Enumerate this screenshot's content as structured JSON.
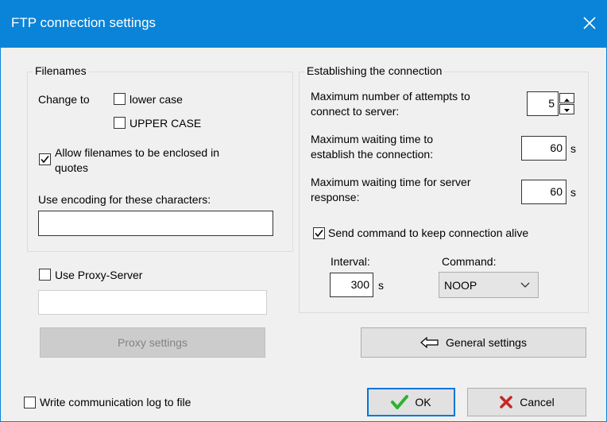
{
  "window": {
    "title": "FTP connection settings"
  },
  "filenames": {
    "legend": "Filenames",
    "change_to": "Change to",
    "lower_case": {
      "label": "lower case",
      "checked": false
    },
    "upper_case": {
      "label": "UPPER CASE",
      "checked": false
    },
    "allow_quotes": {
      "label_line1": "Allow filenames to be enclosed in",
      "label_line2": "quotes",
      "checked": true
    },
    "encoding_label": "Use encoding for these characters:",
    "encoding_value": ""
  },
  "proxy": {
    "label": "Use Proxy-Server",
    "checked": false,
    "server_value": "",
    "settings_button": "Proxy settings"
  },
  "connection": {
    "legend": "Establishing the connection",
    "attempts_label_line1": "Maximum number of attempts to",
    "attempts_label_line2": "connect to server:",
    "attempts_value": "5",
    "wait_label_line1": "Maximum waiting time to",
    "wait_label_line2": "establish the connection:",
    "wait_value": "60",
    "wait_unit": "s",
    "response_label_line1": "Maximum waiting time for server",
    "response_label_line2": "response:",
    "response_value": "60",
    "response_unit": "s",
    "keep_alive": {
      "label": "Send command to keep connection alive",
      "checked": true
    },
    "interval_label": "Interval:",
    "interval_value": "300",
    "interval_unit": "s",
    "command_label": "Command:",
    "command_value": "NOOP"
  },
  "general_settings_button": "General settings",
  "log": {
    "label": "Write communication log to file",
    "checked": false
  },
  "ok_button": "OK",
  "cancel_button": "Cancel",
  "colors": {
    "titlebar": "#0a84d8",
    "ok_check": "#2db22d",
    "cancel_x": "#c62828",
    "client_bg": "#f0f0f0"
  }
}
